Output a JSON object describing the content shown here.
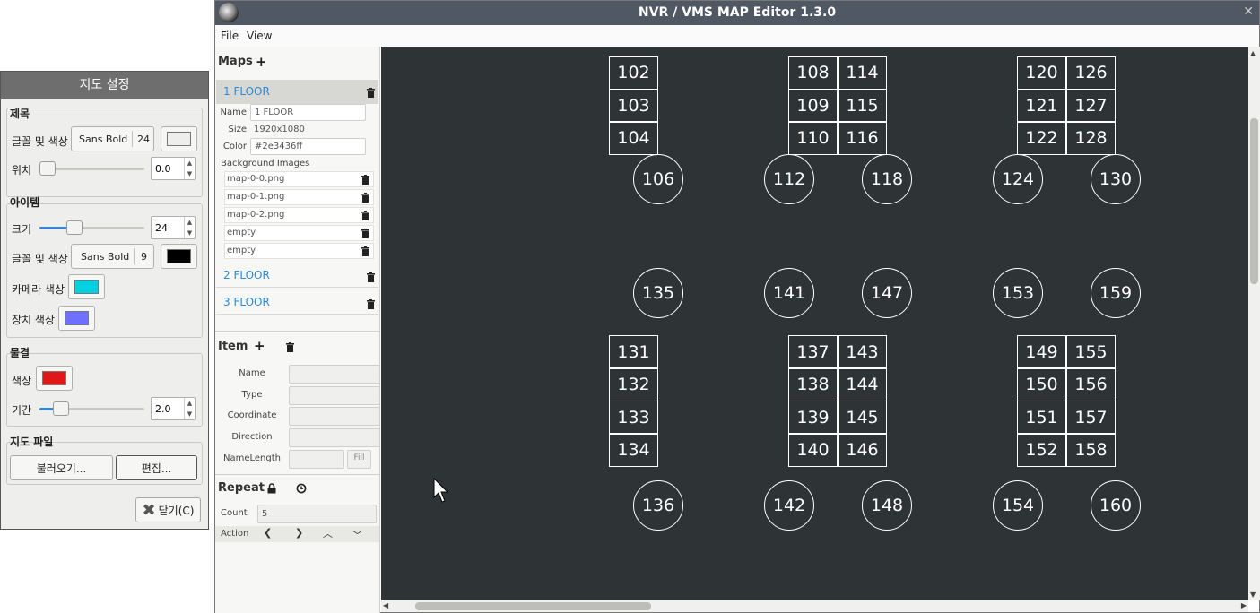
{
  "settings_dialog": {
    "title": "지도 설정",
    "title_group": {
      "label": "제목",
      "font_color_label": "글꼴 및 색상",
      "font_name": "Sans Bold",
      "font_size": "24",
      "color": "#eeeeec",
      "position_label": "위치",
      "position_value": "0.0",
      "position_level": 0.0
    },
    "item_group": {
      "label": "아이템",
      "size_label": "크기",
      "size_value": "24",
      "size_level": 0.3,
      "font_color_label": "글꼴 및 색상",
      "font_name": "Sans Bold",
      "font_size": "9",
      "font_color": "#000000",
      "camera_color_label": "카메라 색상",
      "camera_color": "#00d0e0",
      "device_color_label": "장치 색상",
      "device_color": "#7070ff"
    },
    "ripple_group": {
      "label": "물결",
      "color_label": "색상",
      "color": "#e01818",
      "duration_label": "기간",
      "duration_value": "2.0",
      "duration_level": 0.15
    },
    "mapfile_group": {
      "label": "지도 파일",
      "load_button": "불러오기...",
      "edit_button": "편집..."
    },
    "close_button": "닫기(C)"
  },
  "window": {
    "title": "NVR / VMS MAP Editor 1.3.0",
    "close_glyph": "✕"
  },
  "menu": {
    "file": "File",
    "view": "View"
  },
  "maps_panel": {
    "heading": "Maps",
    "add_glyph": "+",
    "floors": [
      {
        "name": "1 FLOOR",
        "selected": true
      },
      {
        "name": "2 FLOOR",
        "selected": false
      },
      {
        "name": "3 FLOOR",
        "selected": false
      }
    ],
    "selected_floor": {
      "name_label": "Name",
      "name_value": "1 FLOOR",
      "size_label": "Size",
      "size_value": "1920x1080",
      "color_label": "Color",
      "color_value": "#2e3436ff",
      "bg_label": "Background Images",
      "bg_images": [
        "map-0-0.png",
        "map-0-1.png",
        "map-0-2.png",
        "empty",
        "empty"
      ]
    }
  },
  "item_panel": {
    "heading": "Item",
    "add_glyph": "+",
    "fields": [
      "Name",
      "Type",
      "Coordinate",
      "Direction",
      "NameLength"
    ],
    "fill_button": "Fill"
  },
  "repeat_panel": {
    "heading": "Repeat",
    "count_label": "Count",
    "count_value": "5",
    "action_label": "Action",
    "action_icons": [
      "arrow-left-icon",
      "arrow-right-icon",
      "arrow-up-icon",
      "arrow-down-icon"
    ]
  },
  "map_canvas": {
    "background": "#2e3436",
    "rect_items": [
      {
        "label": "102",
        "col": 0,
        "row": -1
      },
      {
        "label": "103",
        "col": 0,
        "row": 0
      },
      {
        "label": "104",
        "col": 0,
        "row": 1
      },
      {
        "label": "108",
        "col": 1,
        "row": -1
      },
      {
        "label": "109",
        "col": 1,
        "row": 0
      },
      {
        "label": "110",
        "col": 1,
        "row": 1
      },
      {
        "label": "114",
        "col": 2,
        "row": -1
      },
      {
        "label": "115",
        "col": 2,
        "row": 0
      },
      {
        "label": "116",
        "col": 2,
        "row": 1
      },
      {
        "label": "120",
        "col": 3,
        "row": -1
      },
      {
        "label": "121",
        "col": 3,
        "row": 0
      },
      {
        "label": "122",
        "col": 3,
        "row": 1
      },
      {
        "label": "126",
        "col": 4,
        "row": -1
      },
      {
        "label": "127",
        "col": 4,
        "row": 0
      },
      {
        "label": "128",
        "col": 4,
        "row": 1
      },
      {
        "label": "131",
        "col": 0,
        "row": 3
      },
      {
        "label": "132",
        "col": 0,
        "row": 4
      },
      {
        "label": "133",
        "col": 0,
        "row": 5
      },
      {
        "label": "134",
        "col": 0,
        "row": 6
      },
      {
        "label": "137",
        "col": 1,
        "row": 3
      },
      {
        "label": "138",
        "col": 1,
        "row": 4
      },
      {
        "label": "139",
        "col": 1,
        "row": 5
      },
      {
        "label": "140",
        "col": 1,
        "row": 6
      },
      {
        "label": "143",
        "col": 2,
        "row": 3
      },
      {
        "label": "144",
        "col": 2,
        "row": 4
      },
      {
        "label": "145",
        "col": 2,
        "row": 5
      },
      {
        "label": "146",
        "col": 2,
        "row": 6
      },
      {
        "label": "149",
        "col": 3,
        "row": 3
      },
      {
        "label": "150",
        "col": 3,
        "row": 4
      },
      {
        "label": "151",
        "col": 3,
        "row": 5
      },
      {
        "label": "152",
        "col": 3,
        "row": 6
      },
      {
        "label": "155",
        "col": 4,
        "row": 3
      },
      {
        "label": "156",
        "col": 4,
        "row": 4
      },
      {
        "label": "157",
        "col": 4,
        "row": 5
      },
      {
        "label": "158",
        "col": 4,
        "row": 6
      }
    ],
    "circle_items": [
      {
        "label": "106",
        "col": 0,
        "row": 0
      },
      {
        "label": "112",
        "col": 1,
        "row": 0
      },
      {
        "label": "118",
        "col": 2,
        "row": 0
      },
      {
        "label": "124",
        "col": 3,
        "row": 0
      },
      {
        "label": "130",
        "col": 4,
        "row": 0
      },
      {
        "label": "135",
        "col": 0,
        "row": 1
      },
      {
        "label": "141",
        "col": 1,
        "row": 1
      },
      {
        "label": "147",
        "col": 2,
        "row": 1
      },
      {
        "label": "153",
        "col": 3,
        "row": 1
      },
      {
        "label": "159",
        "col": 4,
        "row": 1
      },
      {
        "label": "136",
        "col": 0,
        "row": 2
      },
      {
        "label": "142",
        "col": 1,
        "row": 2
      },
      {
        "label": "148",
        "col": 2,
        "row": 2
      },
      {
        "label": "154",
        "col": 3,
        "row": 2
      },
      {
        "label": "160",
        "col": 4,
        "row": 2
      }
    ]
  }
}
